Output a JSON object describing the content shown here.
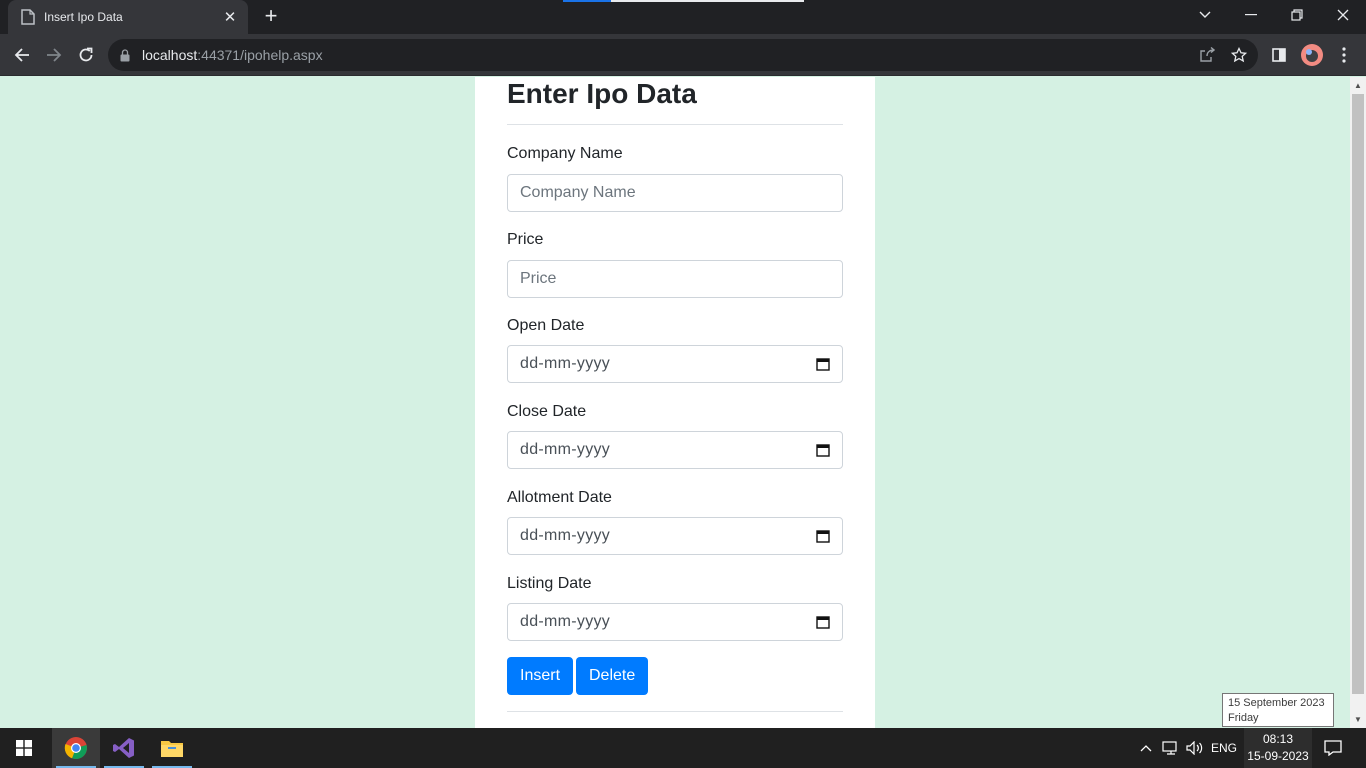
{
  "browser": {
    "tab_title": "Insert Ipo Data",
    "url_host": "localhost",
    "url_rest": ":44371/ipohelp.aspx"
  },
  "form": {
    "heading": "Enter Ipo Data",
    "fields": [
      {
        "label": "Company Name",
        "placeholder": "Company Name",
        "type": "text"
      },
      {
        "label": "Price",
        "placeholder": "Price",
        "type": "text"
      },
      {
        "label": "Open Date",
        "value": "dd-mm-yyyy",
        "type": "date"
      },
      {
        "label": "Close Date",
        "value": "dd-mm-yyyy",
        "type": "date"
      },
      {
        "label": "Allotment Date",
        "value": "dd-mm-yyyy",
        "type": "date"
      },
      {
        "label": "Listing Date",
        "value": "dd-mm-yyyy",
        "type": "date"
      }
    ],
    "insert_label": "Insert",
    "delete_label": "Delete",
    "button_color": "#007bff"
  },
  "tooltip": {
    "date_line": "15 September 2023",
    "day_line": "Friday"
  },
  "taskbar": {
    "language": "ENG",
    "time": "08:13",
    "date": "15-09-2023"
  },
  "colors": {
    "page_background": "#d5f1e3",
    "chrome_dark": "#202124",
    "taskbar": "#202020"
  }
}
